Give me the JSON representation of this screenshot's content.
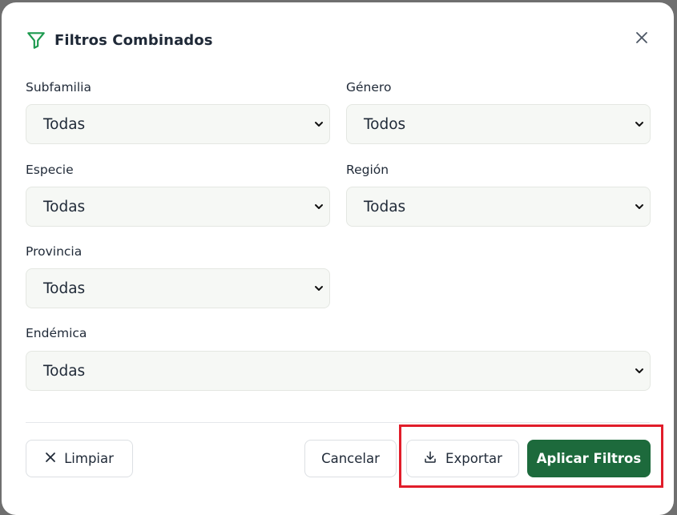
{
  "dialog": {
    "title": "Filtros Combinados",
    "icon": "filter-icon",
    "accent_color": "#1d6a3c"
  },
  "fields": {
    "subfamilia": {
      "label": "Subfamilia",
      "value": "Todas"
    },
    "genero": {
      "label": "Género",
      "value": "Todos"
    },
    "especie": {
      "label": "Especie",
      "value": "Todas"
    },
    "region": {
      "label": "Región",
      "value": "Todas"
    },
    "provincia": {
      "label": "Provincia",
      "value": "Todas"
    },
    "endemica": {
      "label": "Endémica",
      "value": "Todas"
    }
  },
  "footer": {
    "clear_label": "Limpiar",
    "cancel_label": "Cancelar",
    "export_label": "Exportar",
    "apply_label": "Aplicar Filtros",
    "highlight_color": "#e11d2a"
  }
}
